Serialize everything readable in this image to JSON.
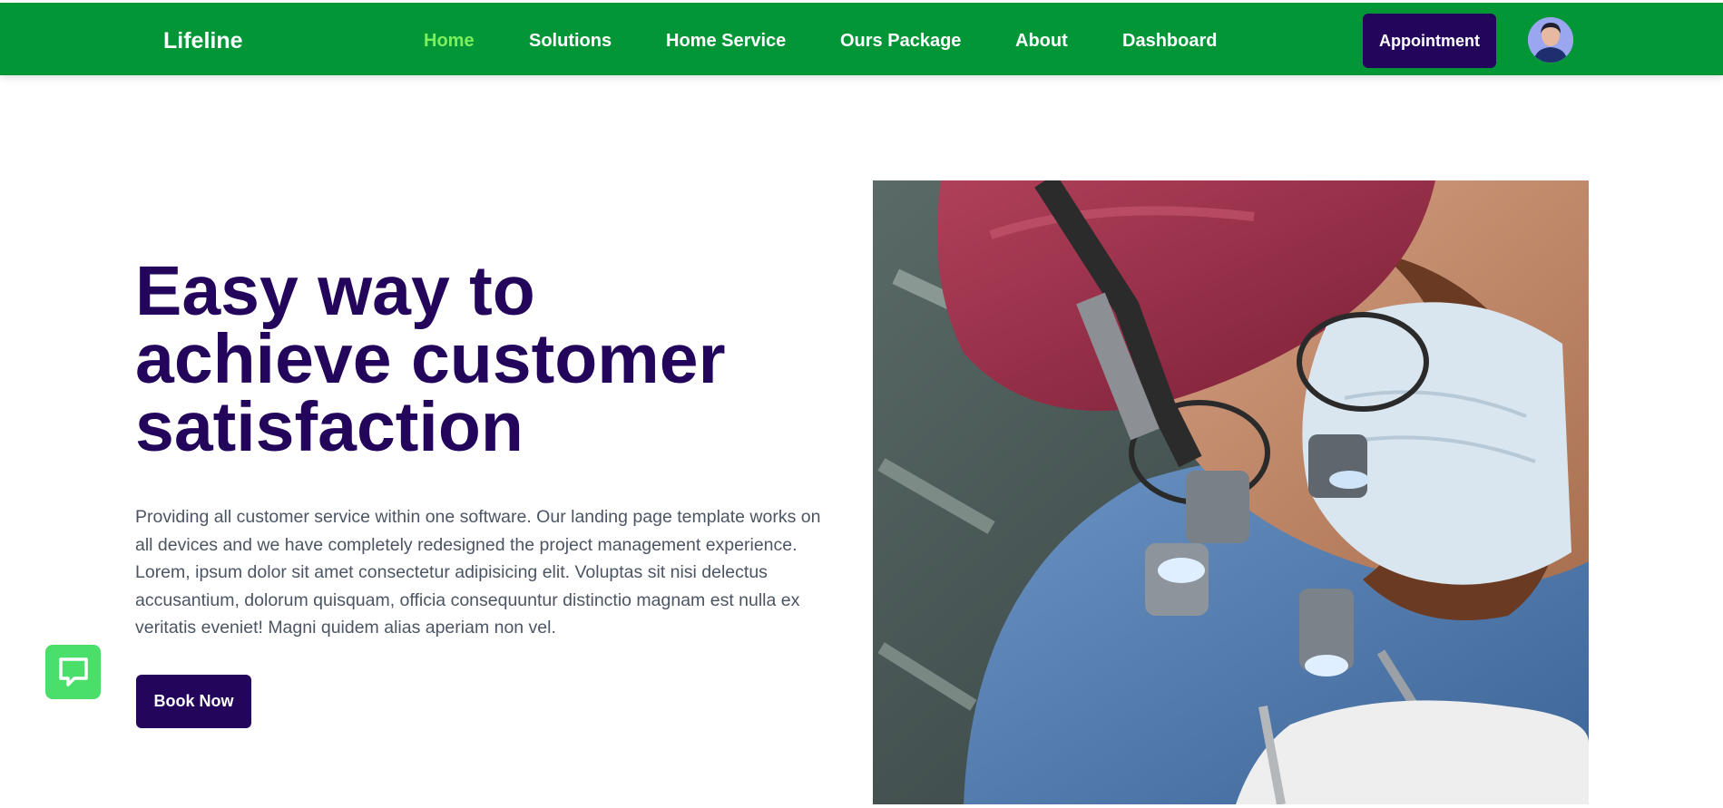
{
  "header": {
    "brand": "Lifeline",
    "nav": [
      {
        "label": "Home",
        "active": true
      },
      {
        "label": "Solutions",
        "active": false
      },
      {
        "label": "Home Service",
        "active": false
      },
      {
        "label": "Ours Package",
        "active": false
      },
      {
        "label": "About",
        "active": false
      },
      {
        "label": "Dashboard",
        "active": false
      }
    ],
    "appointment_label": "Appointment",
    "avatar_icon": "user-avatar"
  },
  "hero": {
    "title_lines": [
      "Easy way to",
      "achieve customer",
      "satisfaction"
    ],
    "description_lines": [
      "Providing all customer service within one software. Our landing page template works on",
      "all devices and we have completely redesigned the project management experience.",
      "Lorem, ipsum dolor sit amet consectetur adipisicing elit. Voluptas sit nisi delectus",
      "accusantium, dolorum quisquam, officia consequuntur distinctio magnam est nulla ex",
      "veritatis eveniet! Magni quidem alias aperiam non vel."
    ],
    "cta_label": "Book Now",
    "image_icon": "surgeon-photo"
  },
  "chat_widget": {
    "icon": "chat-bubble-icon"
  },
  "colors": {
    "header_bg": "#029637",
    "active_nav": "#7cf05c",
    "primary_dark": "#23065c",
    "chat_green": "#4ade6a",
    "body_text": "#4b5563"
  }
}
